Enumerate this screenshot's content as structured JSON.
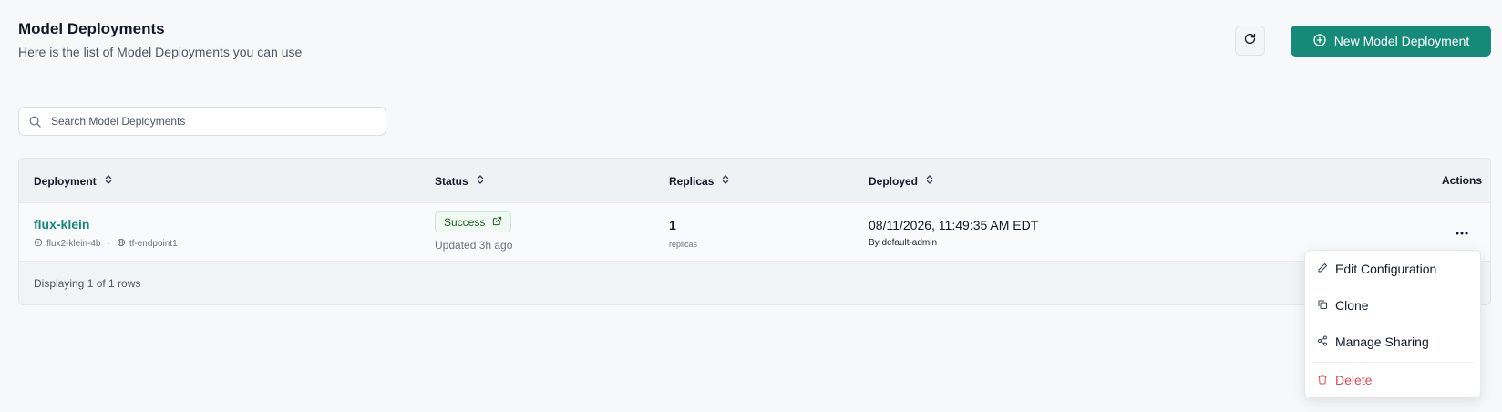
{
  "header": {
    "title": "Model Deployments",
    "subtitle": "Here is the list of Model Deployments you can use",
    "refresh_icon": "refresh-icon",
    "new_button_label": "New Model Deployment",
    "new_button_icon": "plus-circle-icon"
  },
  "search": {
    "placeholder": "Search Model Deployments",
    "value": ""
  },
  "table": {
    "columns": [
      {
        "label": "Deployment",
        "sortable": true
      },
      {
        "label": "Status",
        "sortable": true
      },
      {
        "label": "Replicas",
        "sortable": true
      },
      {
        "label": "Deployed",
        "sortable": true
      },
      {
        "label": "Actions",
        "sortable": false
      }
    ],
    "rows": [
      {
        "name": "flux-klein",
        "model": "flux2-klein-4b",
        "endpoint": "tf-endpoint1",
        "status": "Success",
        "updated": "Updated 3h ago",
        "replicas": "1",
        "replicas_label": "replicas",
        "deployed_at": "08/11/2026, 11:49:35 AM EDT",
        "deployed_by": "By default-admin"
      }
    ],
    "footer": "Displaying 1 of 1 rows"
  },
  "actions_menu": {
    "items": [
      {
        "label": "Edit Configuration",
        "icon": "pencil-icon"
      },
      {
        "label": "Clone",
        "icon": "copy-icon"
      },
      {
        "label": "Manage Sharing",
        "icon": "share-icon"
      },
      {
        "label": "Delete",
        "icon": "trash-icon"
      }
    ]
  },
  "colors": {
    "accent": "#168a78",
    "success_text": "#1b5e20",
    "danger": "#e0484e"
  }
}
